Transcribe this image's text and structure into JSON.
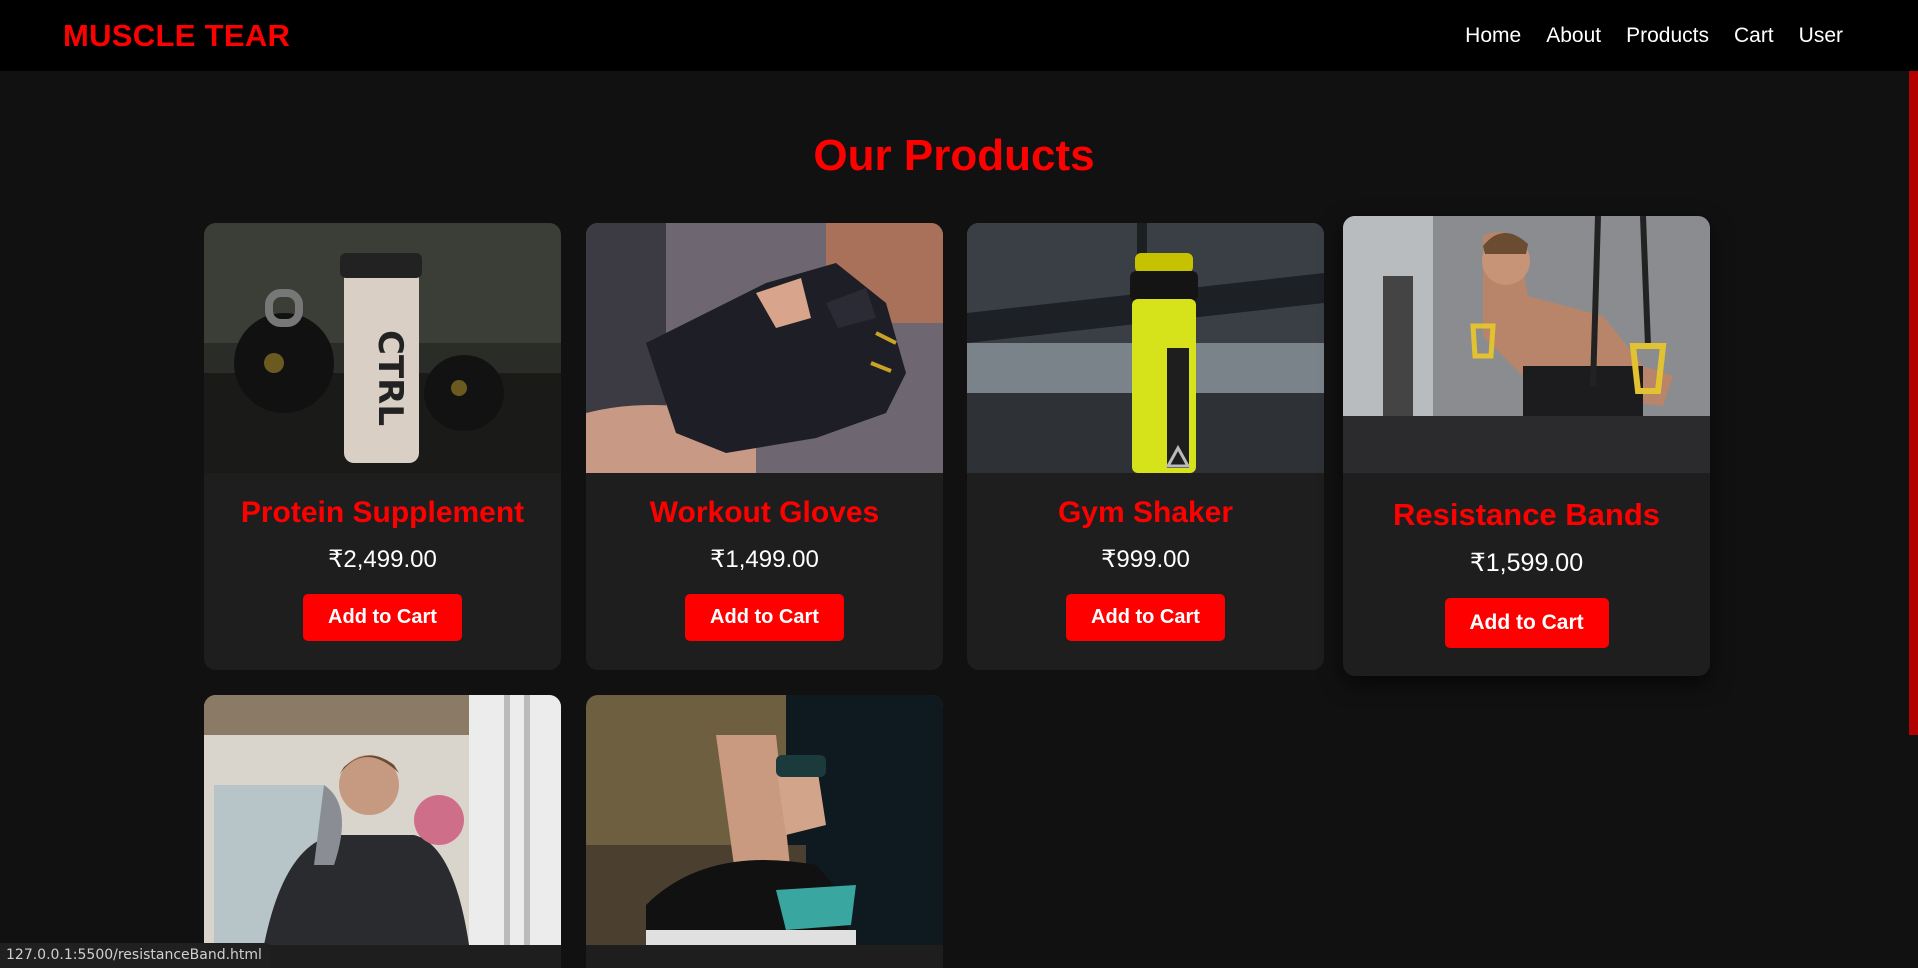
{
  "brand": "MUSCLE TEAR",
  "nav": [
    {
      "label": "Home"
    },
    {
      "label": "About"
    },
    {
      "label": "Products"
    },
    {
      "label": "Cart"
    },
    {
      "label": "User"
    }
  ],
  "section_title": "Our Products",
  "products": [
    {
      "title": "Protein Supplement",
      "price": "₹2,499.00",
      "button": "Add to Cart"
    },
    {
      "title": "Workout Gloves",
      "price": "₹1,499.00",
      "button": "Add to Cart"
    },
    {
      "title": "Gym Shaker",
      "price": "₹999.00",
      "button": "Add to Cart"
    },
    {
      "title": "Resistance Bands",
      "price": "₹1,599.00",
      "button": "Add to Cart"
    }
  ],
  "status_url": "127.0.0.1:5500/resistanceBand.html",
  "colors": {
    "accent": "#ff0000",
    "background": "#111111",
    "navbar": "#000000",
    "card": "#1e1e1e"
  }
}
